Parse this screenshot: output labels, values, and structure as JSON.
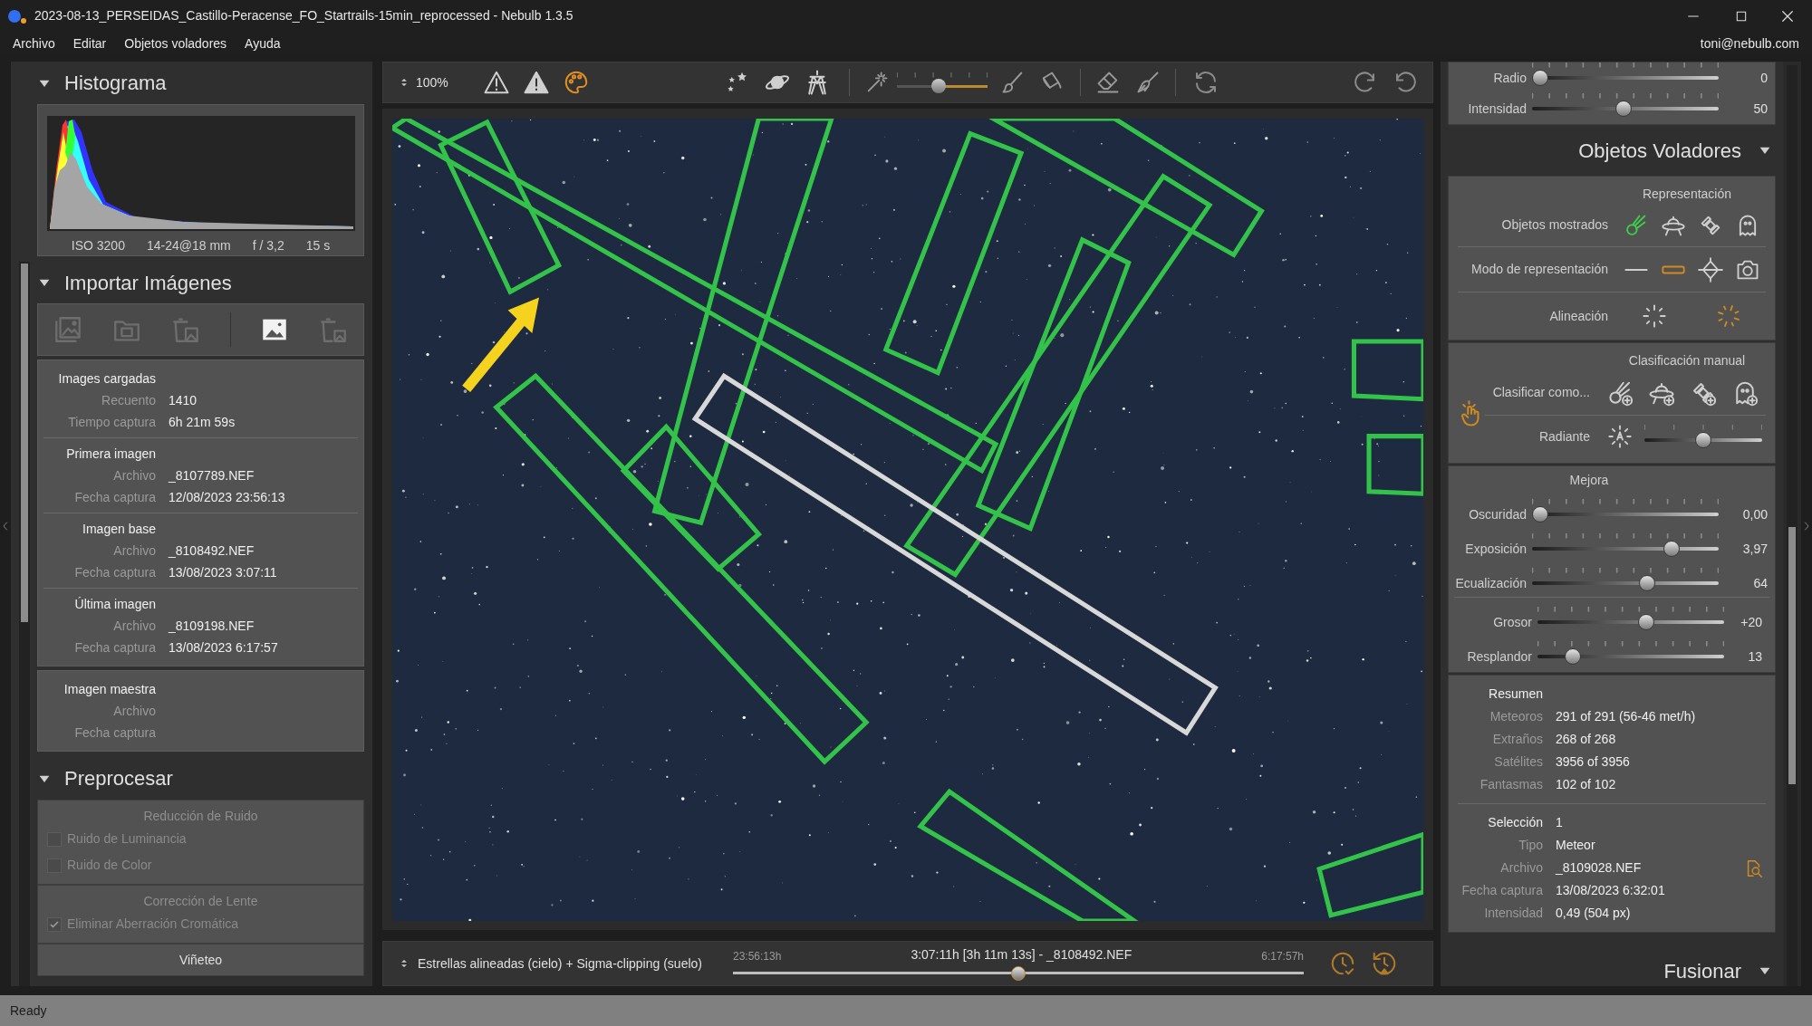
{
  "window": {
    "title": "2023-08-13_PERSEIDAS_Castillo-Peracense_FO_Startrails-15min_reprocessed - Nebulb 1.3.5"
  },
  "menu": [
    {
      "label": "Archivo"
    },
    {
      "label": "Editar"
    },
    {
      "label": "Objetos voladores"
    },
    {
      "label": "Ayuda"
    }
  ],
  "account": "toni@nebulb.com",
  "histogram": {
    "title": "Histograma",
    "expanded": true,
    "exif": [
      "ISO 3200",
      "14-24@18 mm",
      "f / 3,2",
      "15 s"
    ]
  },
  "import": {
    "title": "Importar Imágenes",
    "expanded": true,
    "tools": [
      {
        "disabled": true
      },
      {
        "disabled": true
      },
      {
        "disabled": true
      },
      {
        "disabled": false
      },
      {
        "disabled": true
      }
    ],
    "cards": [
      {
        "groups": [
          {
            "title": "Images cargadas",
            "rows": [
              {
                "label": "Recuento",
                "value": "1410"
              },
              {
                "label": "Tiempo captura",
                "value": "6h 21m 59s"
              }
            ]
          },
          {
            "title": "Primera imagen",
            "rows": [
              {
                "label": "Archivo",
                "value": "_8107789.NEF"
              },
              {
                "label": "Fecha captura",
                "value": "12/08/2023 23:56:13"
              }
            ]
          },
          {
            "title": "Imagen base",
            "rows": [
              {
                "label": "Archivo",
                "value": "_8108492.NEF"
              },
              {
                "label": "Fecha captura",
                "value": "13/08/2023 3:07:11"
              }
            ]
          },
          {
            "title": "Última imagen",
            "rows": [
              {
                "label": "Archivo",
                "value": "_8109198.NEF"
              },
              {
                "label": "Fecha captura",
                "value": "13/08/2023 6:17:57"
              }
            ]
          }
        ]
      },
      {
        "groups": [
          {
            "title": "Imagen maestra",
            "rows": [
              {
                "label": "Archivo"
              },
              {
                "label": "Fecha captura"
              }
            ]
          }
        ]
      }
    ]
  },
  "preprocess": {
    "title": "Preprocesar",
    "expanded": true,
    "sections": [
      {
        "title": "Reducción de Ruido",
        "disabled": true,
        "options": [
          {
            "label": "Ruido de Luminancia",
            "checked": false,
            "disabled": true
          },
          {
            "label": "Ruido de Color",
            "checked": false,
            "disabled": true
          }
        ]
      },
      {
        "title": "Corrección de Lente",
        "disabled": true,
        "options": [
          {
            "label": "Eliminar Aberración Cromática",
            "checked": true,
            "disabled": true
          }
        ]
      },
      {
        "title": "Viñeteo",
        "disabled": false
      }
    ]
  },
  "toolbar": {
    "zoom": "100%",
    "color_overlay_on": true,
    "brush": {
      "level": 0.45
    }
  },
  "bottom_bar": {
    "mode": "Estrellas alineadas (cielo) + Sigma-clipping (suelo)",
    "start": "23:56:13h",
    "current": "3:07:11h [3h 11m 13s] - _8108492.NEF",
    "end": "6:17:57h",
    "level": 0.5
  },
  "right_panel": {
    "top_sliders": [
      {
        "label": "Radio",
        "value": "0",
        "level": 0
      },
      {
        "label": "Intensidad",
        "value": "50",
        "level": 0.49
      }
    ],
    "title": "Objetos Voladores",
    "expanded": true,
    "representation": {
      "title": "Representación",
      "shown_label": "Objetos mostrados",
      "shown": [
        {
          "on": true
        },
        {
          "on": false
        },
        {
          "on": false
        },
        {
          "on": false
        }
      ],
      "mode_label": "Modo de representación",
      "modes": [
        {
          "selected": false
        },
        {
          "selected": true
        },
        {
          "selected": false
        },
        {
          "selected": false
        }
      ],
      "alignment_label": "Alineación",
      "alignments": [
        {
          "selected": false
        },
        {
          "selected": true
        }
      ]
    },
    "manual": {
      "title": "Clasificación manual",
      "active": true,
      "classify_label": "Clasificar como...",
      "radiant_label": "Radiante",
      "radiant": {
        "level": 0.5
      }
    },
    "enhance": {
      "title": "Mejora",
      "slider_groups": [
        {
          "sliders": [
            {
              "label": "Oscuridad",
              "value": "0,00",
              "level": 0
            },
            {
              "label": "Exposición",
              "value": "3,97",
              "level": 0.77
            },
            {
              "label": "Ecualización",
              "value": "64",
              "level": 0.63
            }
          ]
        },
        {
          "sliders": [
            {
              "label": "Grosor",
              "value": "+20",
              "level": 0.59
            },
            {
              "label": "Resplandor",
              "value": "13",
              "level": 0.16
            }
          ]
        }
      ]
    },
    "summary": {
      "title": "Resumen",
      "rows": [
        {
          "label": "Meteoros",
          "value": "291 of 291 (56-46 met/h)"
        },
        {
          "label": "Extraños",
          "value": "268 of 268"
        },
        {
          "label": "Satélites",
          "value": "3956 of 3956"
        },
        {
          "label": "Fantasmas",
          "value": "102 of 102"
        }
      ],
      "selection_label": "Selección",
      "selection_value": "1",
      "selection_rows": [
        {
          "label": "Tipo",
          "value": "Meteor"
        },
        {
          "label": "Archivo",
          "value": "_8109028.NEF"
        },
        {
          "label": "Fecha captura",
          "value": "13/08/2023 6:32:01"
        },
        {
          "label": "Intensidad",
          "value": "0,49 (504 px)"
        }
      ]
    },
    "next_section": {
      "title": "Fusionar",
      "expanded": true
    }
  },
  "status_bar": "Ready"
}
